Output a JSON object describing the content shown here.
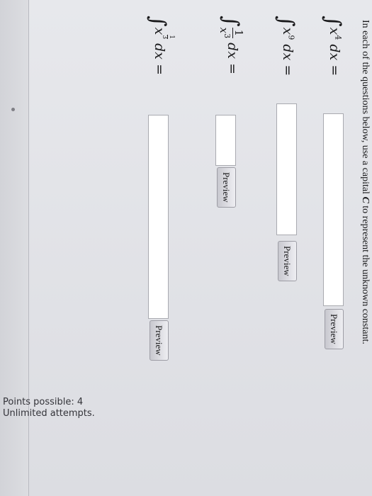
{
  "instructions": {
    "text_before": "In each of the questions below, use a capital ",
    "capital_letter": "C",
    "text_after": " to represent the unknown constant."
  },
  "questions": [
    {
      "variable": "x",
      "exponent": "4",
      "differential": "dx",
      "equals": "=",
      "answer_value": "",
      "preview_label": "Preview"
    },
    {
      "variable": "x",
      "exponent": "9",
      "differential": "dx",
      "equals": "=",
      "answer_value": "",
      "preview_label": "Preview"
    },
    {
      "numerator": "1",
      "den_variable": "x",
      "den_exponent": "3",
      "differential": "dx",
      "equals": "=",
      "answer_value": "",
      "preview_label": "Preview"
    },
    {
      "variable": "x",
      "exp_numerator": "1",
      "exp_denominator": "3",
      "differential": "dx",
      "equals": "=",
      "answer_value": "",
      "preview_label": "Preview"
    }
  ],
  "footer": {
    "points": "Points possible: 4",
    "attempts": "Unlimited attempts."
  },
  "colors": {
    "page_background": "#dcdde2",
    "input_background": "#ffffff",
    "button_background": "#d9d9df",
    "text": "#1a1a1c"
  }
}
